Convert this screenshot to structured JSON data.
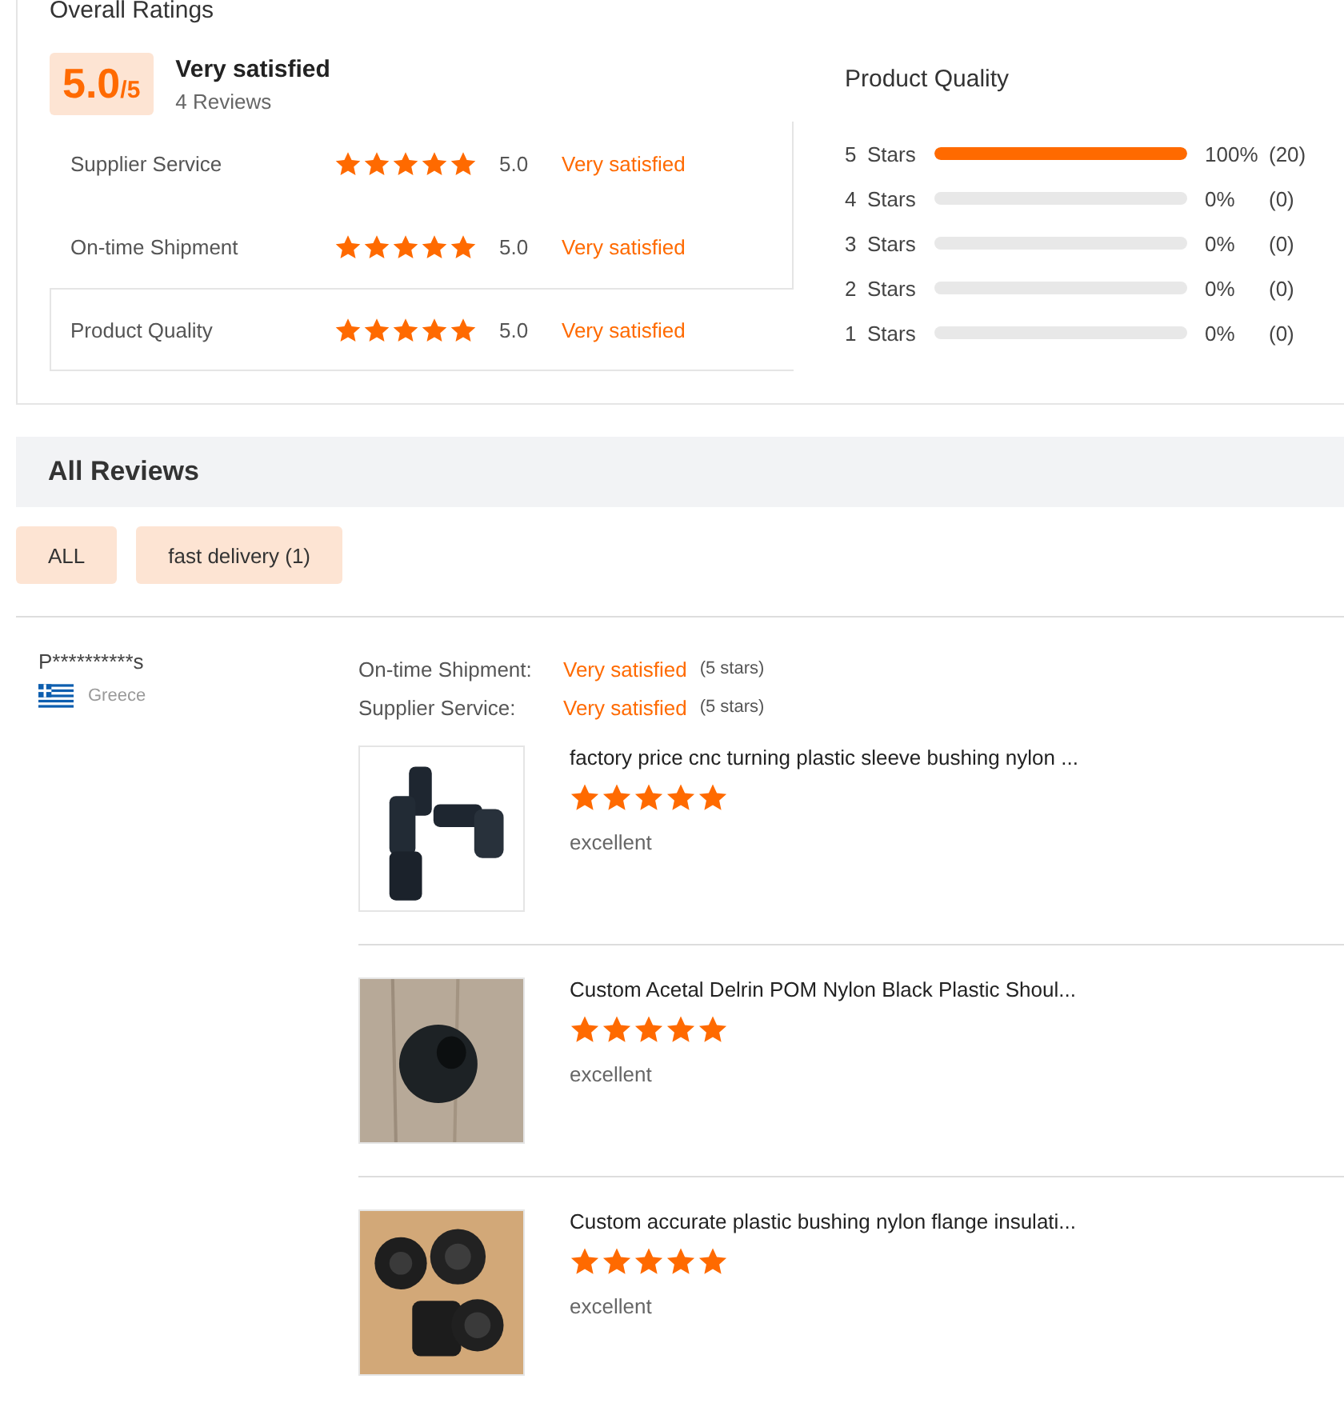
{
  "overall": {
    "title": "Overall Ratings",
    "score": "5.0",
    "score_max": "/5",
    "verdict": "Very satisfied",
    "reviews": "4 Reviews",
    "rows": [
      {
        "label": "Supplier Service",
        "stars": 5,
        "value": "5.0",
        "verdict": "Very satisfied",
        "selected": false
      },
      {
        "label": "On-time Shipment",
        "stars": 5,
        "value": "5.0",
        "verdict": "Very satisfied",
        "selected": false
      },
      {
        "label": "Product Quality",
        "stars": 5,
        "value": "5.0",
        "verdict": "Very satisfied",
        "selected": true
      }
    ]
  },
  "breakdown": {
    "title": "Product Quality",
    "rows": [
      {
        "label": "5",
        "unit": "Stars",
        "level": 1,
        "percent": "100%",
        "count": "(20)"
      },
      {
        "label": "4",
        "unit": "Stars",
        "level": 0,
        "percent": "0%",
        "count": "(0)"
      },
      {
        "label": "3",
        "unit": "Stars",
        "level": 0,
        "percent": "0%",
        "count": "(0)"
      },
      {
        "label": "2",
        "unit": "Stars",
        "level": 0,
        "percent": "0%",
        "count": "(0)"
      },
      {
        "label": "1",
        "unit": "Stars",
        "level": 0,
        "percent": "0%",
        "count": "(0)"
      }
    ]
  },
  "all_reviews": {
    "title": "All Reviews",
    "filters": [
      "ALL",
      "fast delivery (1)"
    ]
  },
  "review": {
    "user": "P**********s",
    "country": "Greece",
    "ratings": [
      {
        "label": "On-time Shipment:",
        "verdict": "Very satisfied",
        "stars_text": "(5 stars)"
      },
      {
        "label": "Supplier Service:",
        "verdict": "Very satisfied",
        "stars_text": "(5 stars)"
      }
    ],
    "products": [
      {
        "kind": "picture",
        "title": "factory price cnc turning plastic sleeve bushing nylon ...",
        "stars": 5,
        "comment": "excellent"
      },
      {
        "kind": "picture",
        "title": "Custom Acetal Delrin POM Nylon Black Plastic Shoul...",
        "stars": 5,
        "comment": "excellent"
      },
      {
        "kind": "picture",
        "title": "Custom accurate plastic bushing nylon flange insulati...",
        "stars": 5,
        "comment": "excellent"
      }
    ]
  }
}
